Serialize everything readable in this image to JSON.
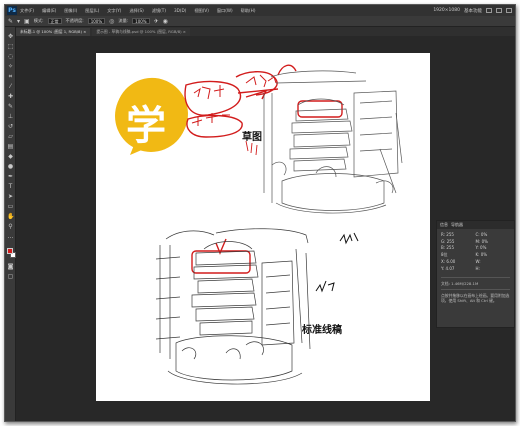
{
  "app": {
    "logo_text": "Ps",
    "menu": [
      "文件(F)",
      "编辑(E)",
      "图像(I)",
      "图层(L)",
      "文字(Y)",
      "选择(S)",
      "滤镜(T)",
      "3D(D)",
      "视图(V)",
      "窗口(W)",
      "帮助(H)"
    ],
    "window_right_text": "1920×1080",
    "window_right_label": "基本功能"
  },
  "options": {
    "tool_icon": "pencil-icon",
    "mode_label": "模式:",
    "mode_value": "正常",
    "opacity_label": "不透明度:",
    "opacity_value": "100%",
    "flow_label": "流量:",
    "flow_value": "100%"
  },
  "tabs": [
    {
      "label": "未标题-1 @ 100% (图层 1, RGB/8) ×",
      "active": true
    },
    {
      "label": "提示图 - 草稿与线稿.psd @ 100% (图层, RGB/8) ×",
      "active": false
    }
  ],
  "colors": {
    "accent_yellow": "#f1b914",
    "annotation_red": "#d21c1c",
    "foreground_swatch": "#d21c1c",
    "background_swatch": "#ffffff"
  },
  "canvas": {
    "badge_char": "学",
    "annotations": [
      "线稿",
      "草稿",
      "线稿"
    ],
    "label_draft": "草图",
    "label_lineart": "标准线稿"
  },
  "info_panel": {
    "tabs": [
      "信息",
      "导航器"
    ],
    "rows": [
      [
        "R:",
        "255",
        "C:",
        "0%"
      ],
      [
        "G:",
        "255",
        "M:",
        "0%"
      ],
      [
        "B:",
        "255",
        "Y:",
        "0%"
      ],
      [
        "8位",
        "",
        "K:",
        "0%"
      ],
      [
        "X:",
        "6.00",
        "W:",
        ""
      ],
      [
        "Y:",
        "4.07",
        "H:",
        ""
      ]
    ],
    "doc_text": "文档: 1.46M/228.1M",
    "hint_text": "点按并拖移以在画布上绘画。要用附加选项，使用 Shift、Alt 和 Ctrl 键。"
  }
}
